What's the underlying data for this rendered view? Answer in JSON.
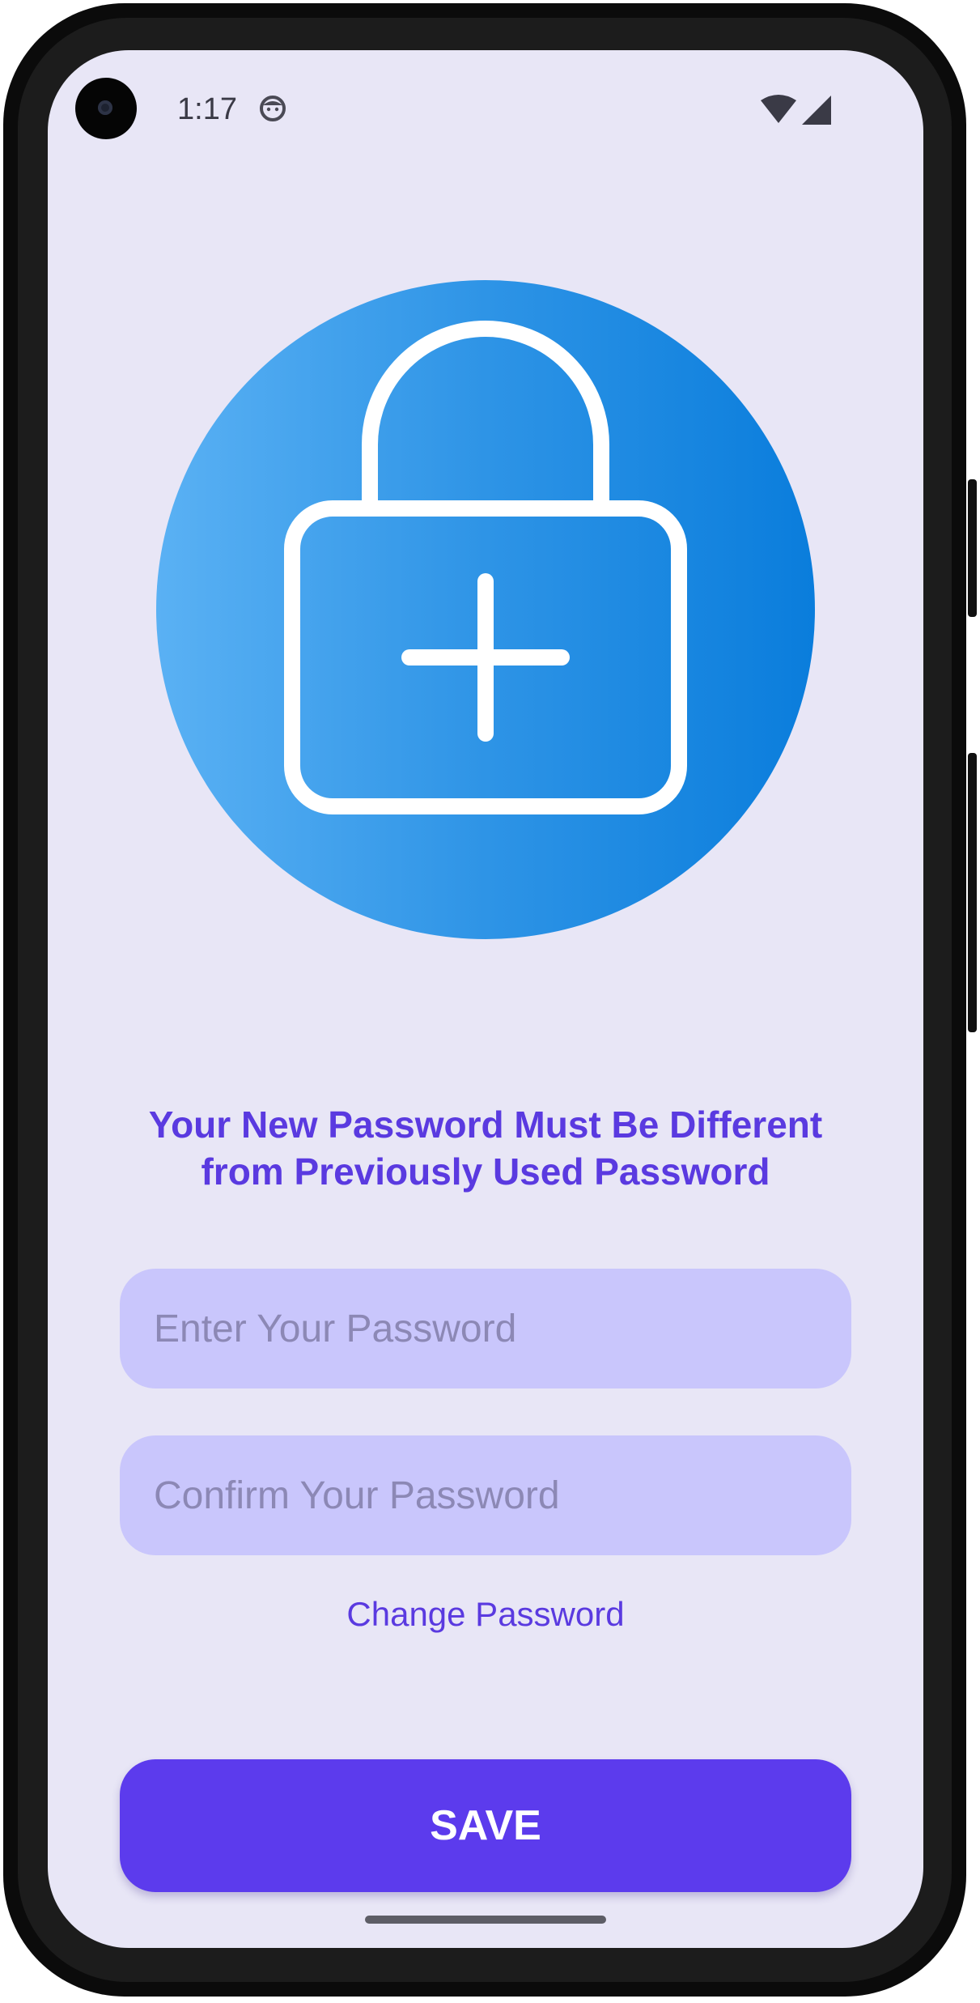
{
  "status_bar": {
    "time": "1:17",
    "icons": [
      "face-notification-icon",
      "wifi-icon",
      "cell-signal-icon"
    ]
  },
  "hero": {
    "icon": "lock-plus-icon",
    "gradient_colors": [
      "#5ab1f4",
      "#0a7ddc"
    ]
  },
  "heading": {
    "line1": "Your New Password Must Be Different",
    "line2": "from Previously Used Password"
  },
  "form": {
    "password_placeholder": "Enter Your Password",
    "confirm_placeholder": "Confirm Your Password",
    "change_password_label": "Change Password",
    "save_label": "SAVE"
  },
  "colors": {
    "background": "#e8e6f6",
    "accent": "#5c3bed",
    "input_fill": "#c9c6fc"
  }
}
